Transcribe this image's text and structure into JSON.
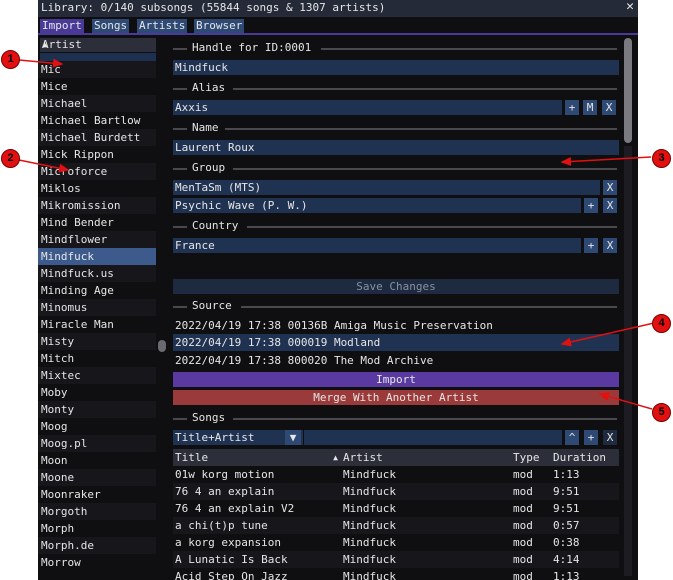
{
  "title": "Library: 0/140 subsongs (55844 songs & 1307 artists)",
  "close_glyph": "✕",
  "tabs": [
    {
      "label": "Import",
      "active": true
    },
    {
      "label": "Songs",
      "active": false
    },
    {
      "label": "Artists",
      "active": false
    },
    {
      "label": "Browser",
      "active": false
    }
  ],
  "artist_list": {
    "header": "Artist",
    "sort_icon": "triangle-up",
    "filter_value": "",
    "items": [
      "Mic",
      "Mice",
      "Michael",
      "Michael Bartlow",
      "Michael Burdett",
      "Mick Rippon",
      "Microforce",
      "Miklos",
      "Mikromission",
      "Mind Bender",
      "Mindflower",
      "Mindfuck",
      "Mindfuck.us",
      "Minding Age",
      "Minomus",
      "Miracle Man",
      "Misty",
      "Mitch",
      "Mixtec",
      "Moby",
      "Monty",
      "Moog",
      "Moog.pl",
      "Moon",
      "Moone",
      "Moonraker",
      "Morgoth",
      "Morph",
      "Morph.de",
      "Morrow"
    ],
    "selected": "Mindfuck"
  },
  "editor": {
    "handle_label": "Handle for ID:0001",
    "handle_value": "Mindfuck",
    "alias_label": "Alias",
    "alias_value": "Axxis",
    "alias_buttons": [
      "+",
      "M",
      "X"
    ],
    "name_label": "Name",
    "name_value": "Laurent Roux",
    "group_label": "Group",
    "groups": [
      {
        "value": "MenTaSm (MTS)",
        "buttons": [
          "X"
        ]
      },
      {
        "value": "Psychic Wave (P. W.)",
        "buttons": [
          "+",
          "X"
        ]
      }
    ],
    "country_label": "Country",
    "country_value": "France",
    "country_buttons": [
      "+",
      "X"
    ],
    "save_label": "Save Changes",
    "source_label": "Source",
    "sources": [
      "2022/04/19 17:38 00136B Amiga Music Preservation",
      "2022/04/19 17:38 000019 Modland",
      "2022/04/19 17:38 800020 The Mod Archive"
    ],
    "import_label": "Import",
    "merge_label": "Merge With Another Artist",
    "songs_label": "Songs",
    "songs_filter_mode": "Title+Artist",
    "songs_filter_value": "",
    "songs_buttons": [
      "^",
      "+",
      "X"
    ],
    "colors": {
      "import": "#5a3aa0",
      "merge": "#9a3a3a",
      "accent": "#4a3a98",
      "field": "#203252"
    }
  },
  "songs_table": {
    "columns": [
      "Title",
      "Artist",
      "Type",
      "Duration"
    ],
    "rows": [
      [
        "01w korg motion",
        "Mindfuck",
        "mod",
        "1:13"
      ],
      [
        "76 4 an explain",
        "Mindfuck",
        "mod",
        "9:51"
      ],
      [
        "76 4 an explain V2",
        "Mindfuck",
        "mod",
        "9:51"
      ],
      [
        "a chi(t)p tune",
        "Mindfuck",
        "mod",
        "0:57"
      ],
      [
        "a korg expansion",
        "Mindfuck",
        "mod",
        "0:38"
      ],
      [
        "A Lunatic Is Back",
        "Mindfuck",
        "mod",
        "4:14"
      ],
      [
        "Acid Step On Jazz",
        "Mindfuck",
        "mod",
        "1:13"
      ]
    ]
  },
  "callouts": [
    "1",
    "2",
    "3",
    "4",
    "5"
  ]
}
